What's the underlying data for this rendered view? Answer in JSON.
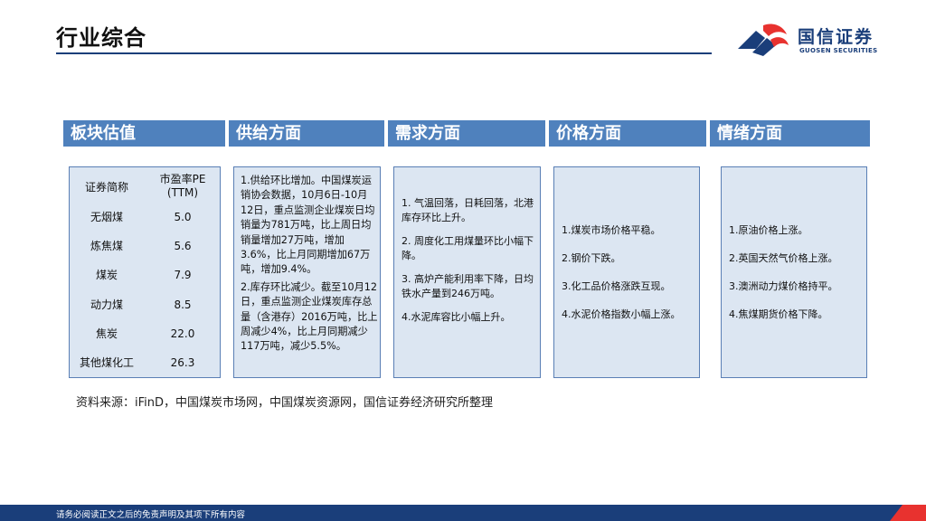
{
  "page": {
    "title": "行业综合"
  },
  "brand": {
    "name_cn": "国信证券",
    "name_en": "GUOSEN SECURITIES",
    "primary_color": "#1a3e7a",
    "accent_color": "#e8322f"
  },
  "columns": {
    "valuation": "板块估值",
    "supply": "供给方面",
    "demand": "需求方面",
    "price": "价格方面",
    "sentiment": "情绪方面"
  },
  "valuation_table": {
    "header": {
      "name": "证券简称",
      "pe_line1": "市盈率PE",
      "pe_line2": "(TTM)"
    },
    "rows": [
      {
        "name": "无烟煤",
        "pe": "5.0"
      },
      {
        "name": "炼焦煤",
        "pe": "5.6"
      },
      {
        "name": "煤炭",
        "pe": "7.9"
      },
      {
        "name": "动力煤",
        "pe": "8.5"
      },
      {
        "name": "焦炭",
        "pe": "22.0"
      },
      {
        "name": "其他煤化工",
        "pe": "26.3"
      }
    ]
  },
  "supply_points": [
    "1.供给环比增加。中国煤炭运销协会数据，10月6日-10月12日，重点监测企业煤炭日均销量为781万吨，比上周日均销量增加27万吨，增加3.6%，比上月同期增加67万吨，增加9.4%。",
    "2.库存环比减少。截至10月12日，重点监测企业煤炭库存总量（含港存）2016万吨，比上周减少4%，比上月同期减少117万吨，减少5.5%。"
  ],
  "demand_points": [
    "1. 气温回落，日耗回落，北港库存环比上升。",
    "2. 周度化工用煤量环比小幅下降。",
    "3. 高炉产能利用率下降，日均铁水产量到246万吨。",
    "4.水泥库容比小幅上升。"
  ],
  "price_points": [
    "1.煤炭市场价格平稳。",
    "2.钢价下跌。",
    "3.化工品价格涨跌互现。",
    "4.水泥价格指数小幅上涨。"
  ],
  "sentiment_points": [
    "1.原油价格上涨。",
    "2.英国天然气价格上涨。",
    "3.澳洲动力煤价格持平。",
    "4.焦煤期货价格下降。"
  ],
  "source": "资料来源：iFinD，中国煤炭市场网，中国煤炭资源网，国信证券经济研究所整理",
  "footer": "请务必阅读正文之后的免责声明及其项下所有内容"
}
